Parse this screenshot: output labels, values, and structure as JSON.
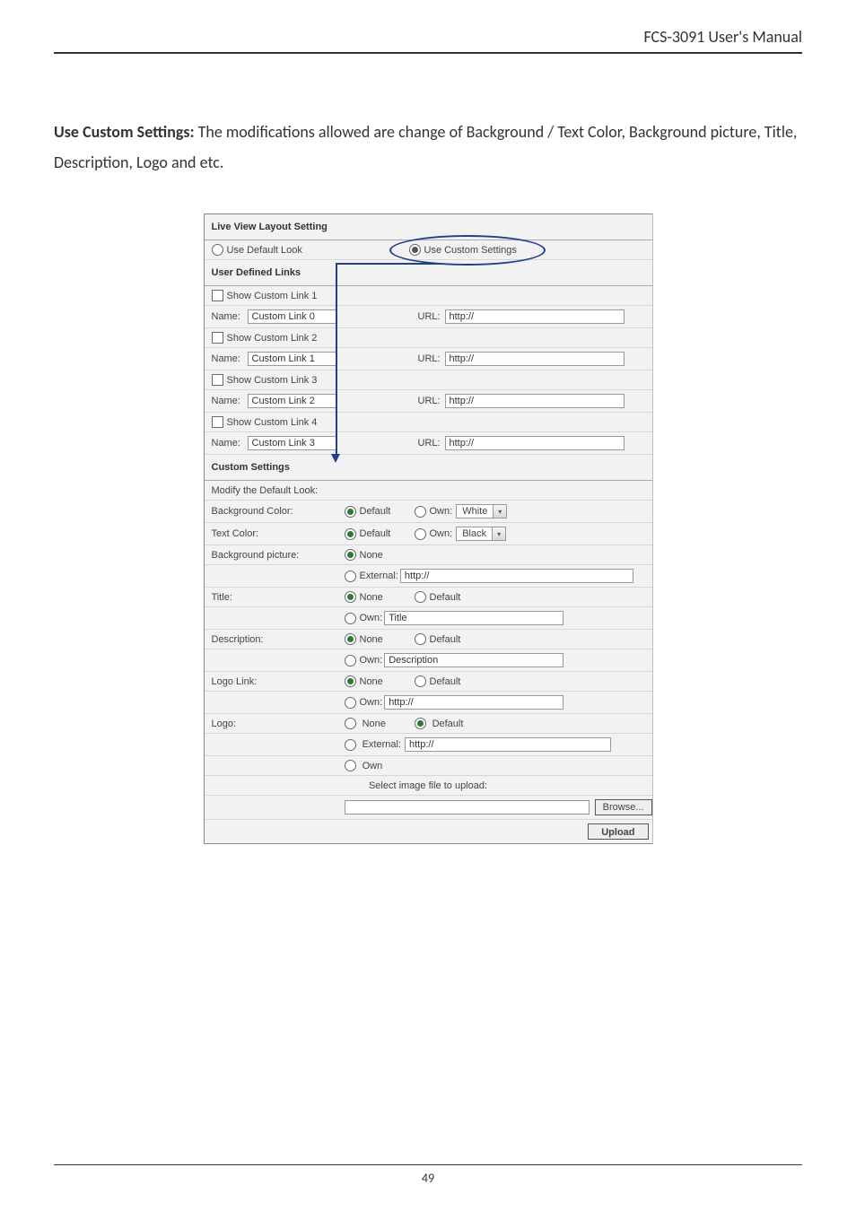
{
  "header": {
    "title": "FCS-3091 User's Manual"
  },
  "intro": {
    "lead": "Use Custom Settings:",
    "rest": " The modifications allowed are change of Background / Text Color, Background picture, Title, Description, Logo and etc."
  },
  "panel": {
    "layout_heading": "Live View Layout Setting",
    "use_default": "Use Default Look",
    "use_custom": "Use Custom Settings",
    "links_heading": "User Defined Links",
    "links": [
      {
        "show": "Show Custom Link  1",
        "name_label": "Name:",
        "name_value": "Custom Link 0",
        "url_label": "URL:",
        "url_value": "http://"
      },
      {
        "show": "Show Custom Link  2",
        "name_label": "Name:",
        "name_value": "Custom Link 1",
        "url_label": "URL:",
        "url_value": "http://"
      },
      {
        "show": "Show Custom Link  3",
        "name_label": "Name:",
        "name_value": "Custom Link 2",
        "url_label": "URL:",
        "url_value": "http://"
      },
      {
        "show": "Show Custom Link  4",
        "name_label": "Name:",
        "name_value": "Custom Link 3",
        "url_label": "URL:",
        "url_value": "http://"
      }
    ],
    "custom_heading": "Custom Settings",
    "modify_label": "Modify the Default Look:",
    "bg_color": {
      "label": "Background Color:",
      "default": "Default",
      "own": "Own:",
      "value": "White"
    },
    "text_color": {
      "label": "Text Color:",
      "default": "Default",
      "own": "Own:",
      "value": "Black"
    },
    "bg_picture": {
      "label": "Background picture:",
      "none": "None",
      "external": "External:",
      "external_value": "http://"
    },
    "title": {
      "label": "Title:",
      "none": "None",
      "default": "Default",
      "own": "Own:",
      "own_value": "Title"
    },
    "desc": {
      "label": "Description:",
      "none": "None",
      "default": "Default",
      "own": "Own:",
      "own_value": "Description"
    },
    "logo_link": {
      "label": "Logo Link:",
      "none": "None",
      "default": "Default",
      "own": "Own:",
      "own_value": "http://"
    },
    "logo": {
      "label": "Logo:",
      "none": "None",
      "default": "Default",
      "external": "External:",
      "external_value": "http://",
      "own": "Own",
      "select_label": "Select image file to upload:",
      "browse": "Browse...",
      "upload": "Upload"
    }
  },
  "footer": {
    "page": "49"
  }
}
